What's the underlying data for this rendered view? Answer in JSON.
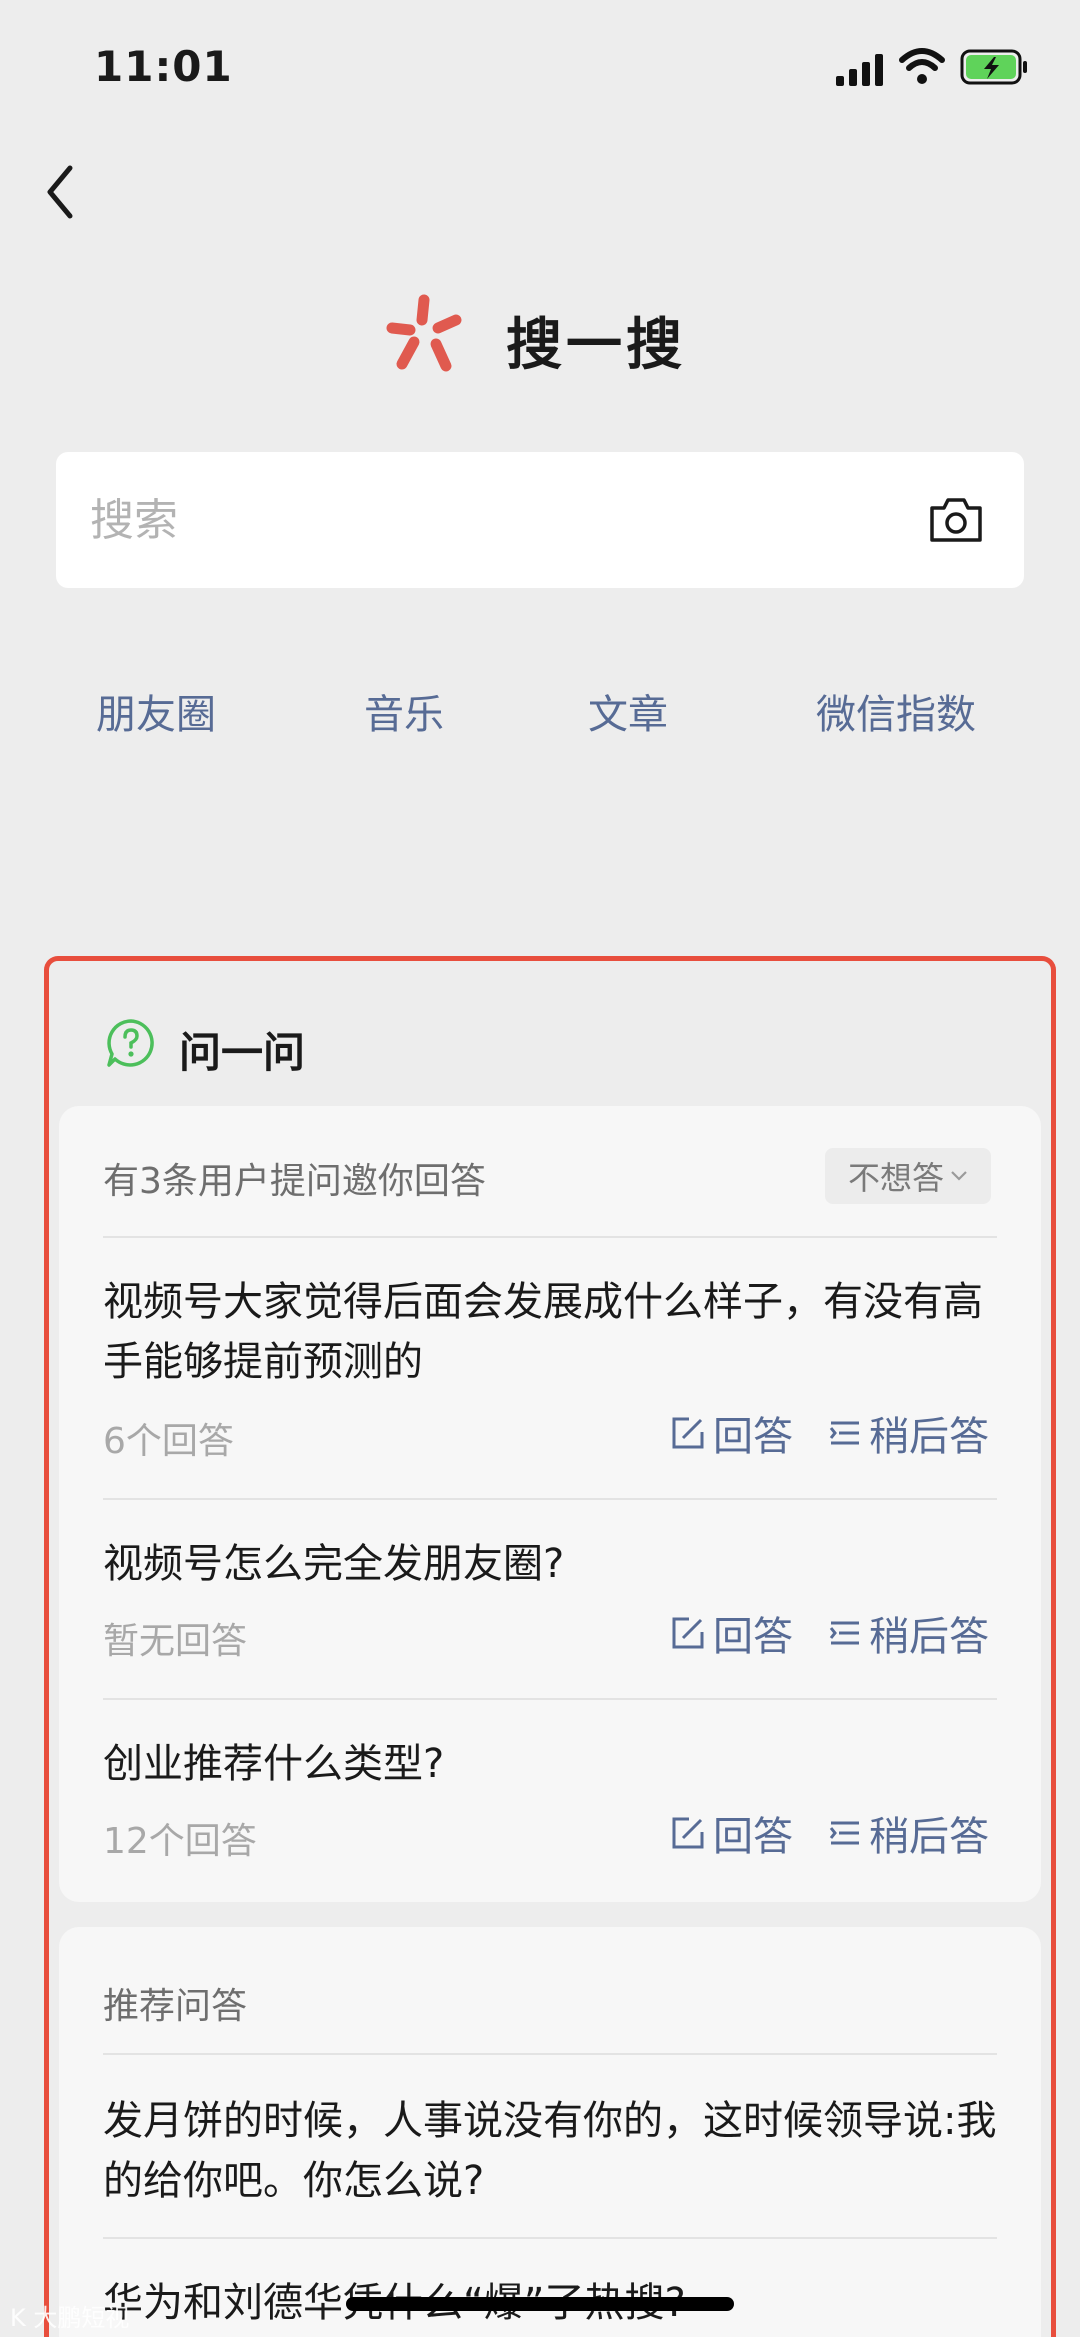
{
  "status_bar": {
    "time": "11:01"
  },
  "brand": {
    "title": "搜一搜"
  },
  "search": {
    "placeholder": "搜索"
  },
  "quick_links": [
    "朋友圈",
    "音乐",
    "文章",
    "微信指数"
  ],
  "ask": {
    "title": "问一问",
    "invite": {
      "label": "有3条用户提问邀你回答",
      "decline_label": "不想答",
      "answer_label": "回答",
      "later_label": "稍后答",
      "questions": [
        {
          "text": "视频号大家觉得后面会发展成什么样子，有没有高手能够提前预测的",
          "count": "6个回答"
        },
        {
          "text": "视频号怎么完全发朋友圈?",
          "count": "暂无回答"
        },
        {
          "text": "创业推荐什么类型?",
          "count": "12个回答"
        }
      ]
    },
    "recommend": {
      "label": "推荐问答",
      "items": [
        "发月饼的时候，人事说没有你的，这时候领导说:我的给你吧。你怎么说?",
        "华为和刘德华凭什么“爆”了热搜?"
      ]
    }
  },
  "watermark": "K 大鹏短视",
  "colors": {
    "accent": "#576b95",
    "highlight_border": "#e84e3d",
    "logo": "#e05a4f"
  }
}
